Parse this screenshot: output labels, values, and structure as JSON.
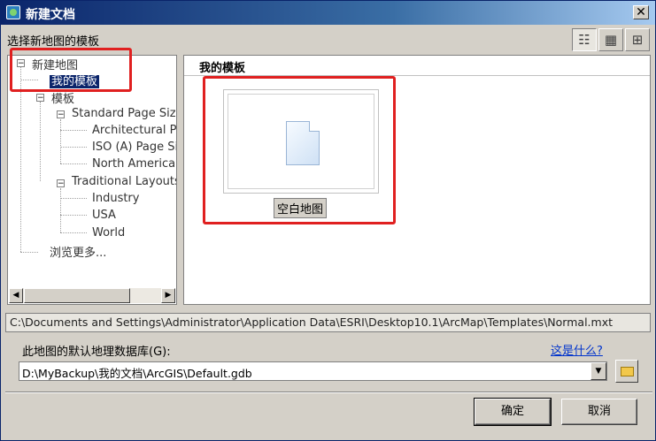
{
  "window": {
    "title": "新建文档",
    "close_label": "✕"
  },
  "section_label": "选择新地图的模板",
  "view_buttons": [
    "details-view",
    "large-icons-view",
    "small-icons-view"
  ],
  "tree": {
    "root": "新建地图",
    "my_templates": "我的模板",
    "templates": "模板",
    "standard_page_sizes": "Standard Page Sizes",
    "architectural": "Architectural Pag",
    "iso": "ISO (A) Page Siz",
    "north_american": "North American (",
    "traditional_layouts": "Traditional Layouts",
    "industry": "Industry",
    "usa": "USA",
    "world": "World",
    "browse_more": "浏览更多...",
    "toggle_open": "−"
  },
  "scroll": {
    "left": "◀",
    "right": "▶"
  },
  "content": {
    "header": "我的模板",
    "item_caption": "空白地图"
  },
  "template_path": "C:\\Documents and Settings\\Administrator\\Application Data\\ESRI\\Desktop10.1\\ArcMap\\Templates\\Normal.mxt",
  "gdb": {
    "label": "此地图的默认地理数据库(G):",
    "help_link": "这是什么?",
    "value": "D:\\MyBackup\\我的文档\\ArcGIS\\Default.gdb",
    "arrow": "▼"
  },
  "buttons": {
    "ok": "确定",
    "cancel": "取消"
  },
  "colors": {
    "highlight": "#e02020",
    "selection": "#0a246a"
  }
}
